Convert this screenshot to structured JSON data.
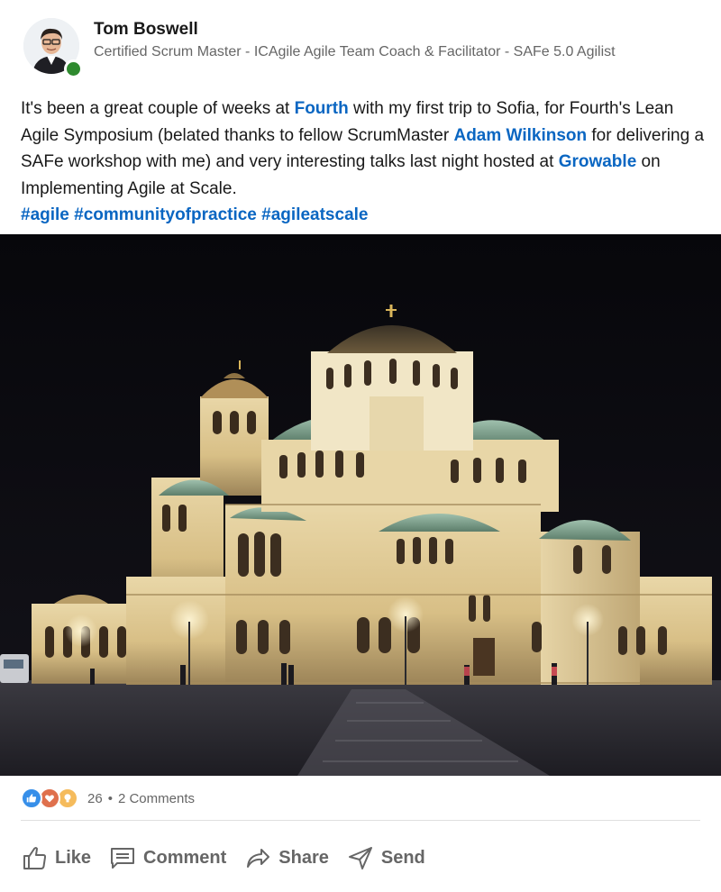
{
  "author": {
    "name": "Tom Boswell",
    "headline": "Certified Scrum Master - ICAgile Agile Team Coach & Facilitator - SAFe 5.0 Agilist",
    "presence": "online",
    "presence_color": "#2f8a2f"
  },
  "post": {
    "text_1": "It's been a great couple of weeks at ",
    "link_fourth": "Fourth",
    "text_2": " with my first trip to Sofia, for Fourth's Lean Agile Symposium (belated thanks to fellow ScrumMaster ",
    "link_adam": "Adam Wilkinson",
    "text_3": " for delivering a SAFe workshop with me) and very interesting talks last night hosted at ",
    "link_growable": "Growable",
    "text_4": " on Implementing Agile at Scale.",
    "hashtags": [
      "#agile",
      "#communityofpractice",
      "#agileatscale"
    ],
    "link_color": "#0a66c2"
  },
  "social": {
    "reactions": [
      "like-icon",
      "love-icon",
      "insightful-icon"
    ],
    "reaction_count": "26",
    "separator": "•",
    "comments": "2 Comments"
  },
  "actions": {
    "like": "Like",
    "comment": "Comment",
    "share": "Share",
    "send": "Send"
  }
}
